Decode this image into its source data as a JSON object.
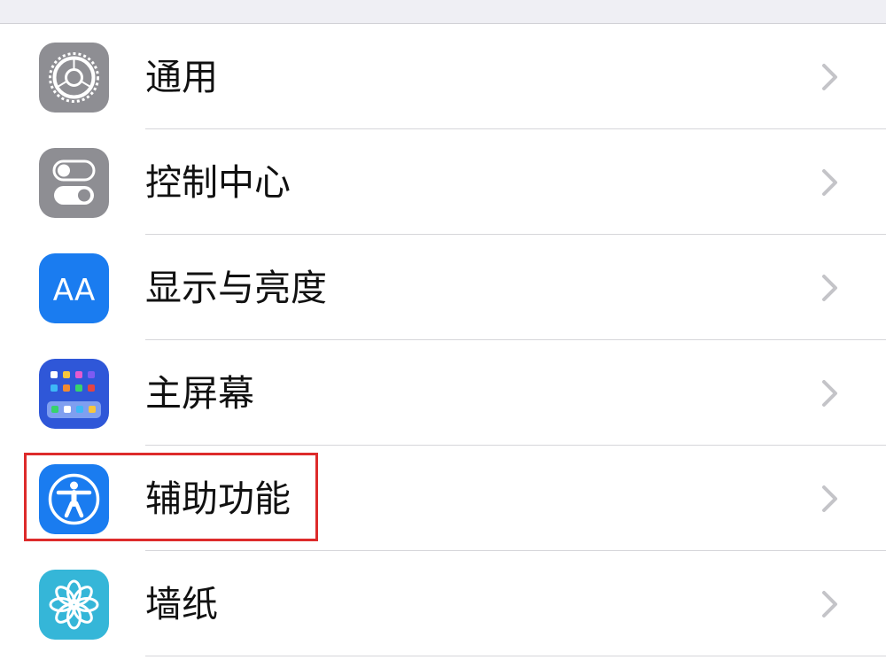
{
  "settings": {
    "items": [
      {
        "label": "通用",
        "icon": "gear-icon",
        "color": "#8e8e93"
      },
      {
        "label": "控制中心",
        "icon": "toggles-icon",
        "color": "#8e8e93"
      },
      {
        "label": "显示与亮度",
        "icon": "text-size-icon",
        "color": "#1a7cf0",
        "icon_text": "AA"
      },
      {
        "label": "主屏幕",
        "icon": "app-grid-icon",
        "color": "#2f57d8"
      },
      {
        "label": "辅助功能",
        "icon": "accessibility-icon",
        "color": "#1a7cf0"
      },
      {
        "label": "墙纸",
        "icon": "flower-icon",
        "color": "#35b6d8"
      }
    ],
    "highlighted_item": "辅助功能",
    "highlight_color": "#dd2b2b"
  }
}
